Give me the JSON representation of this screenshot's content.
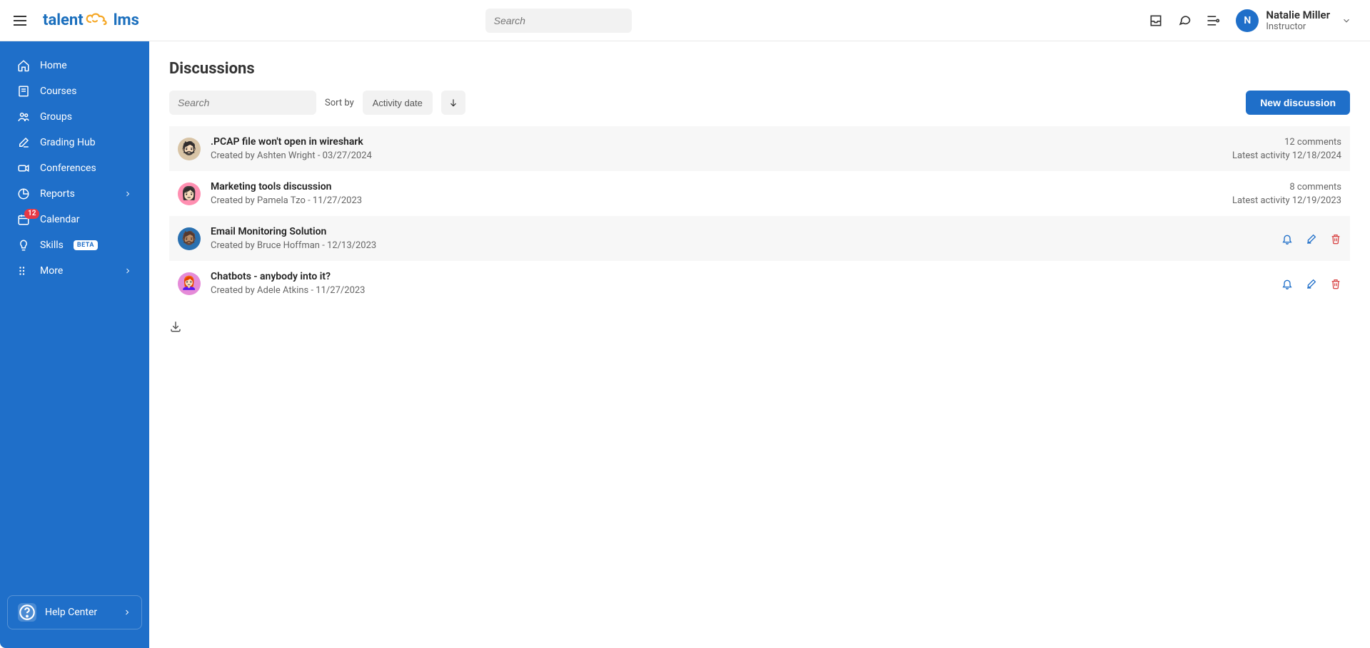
{
  "header": {
    "search_placeholder": "Search",
    "user": {
      "initial": "N",
      "name": "Natalie Miller",
      "role": "Instructor"
    }
  },
  "logo": {
    "part1": "talent",
    "part2": "lms"
  },
  "sidebar": {
    "items": [
      {
        "label": "Home"
      },
      {
        "label": "Courses"
      },
      {
        "label": "Groups"
      },
      {
        "label": "Grading Hub"
      },
      {
        "label": "Conferences"
      },
      {
        "label": "Reports"
      },
      {
        "label": "Calendar",
        "badge": "12"
      },
      {
        "label": "Skills",
        "beta": "BETA"
      },
      {
        "label": "More"
      }
    ],
    "help": "Help Center"
  },
  "page": {
    "title": "Discussions",
    "toolbar": {
      "search_placeholder": "Search",
      "sort_label": "Sort by",
      "sort_value": "Activity date",
      "new_btn": "New discussion"
    },
    "discussions": [
      {
        "title": ".PCAP file won't open in wireshark",
        "creator": "Ashten Wright",
        "date": "03/27/2024",
        "comments": "12 comments",
        "activity": "Latest activity 12/18/2024",
        "avatar_bg": "#d8c4a6",
        "avatar": "🧔🏻"
      },
      {
        "title": "Marketing tools discussion",
        "creator": "Pamela Tzo",
        "date": "11/27/2023",
        "comments": "8 comments",
        "activity": "Latest activity 12/19/2023",
        "avatar_bg": "#ff8fb1",
        "avatar": "👩🏻"
      },
      {
        "title": "Email Monitoring Solution",
        "creator": "Bruce Hoffman",
        "date": "12/13/2023",
        "avatar_bg": "#2a70b0",
        "avatar": "🧔🏽"
      },
      {
        "title": "Chatbots - anybody into it?",
        "creator": "Adele Atkins",
        "date": "11/27/2023",
        "avatar_bg": "#e58bd8",
        "avatar": "👩🏻‍🦰"
      }
    ],
    "created_by_prefix": "Created by "
  }
}
